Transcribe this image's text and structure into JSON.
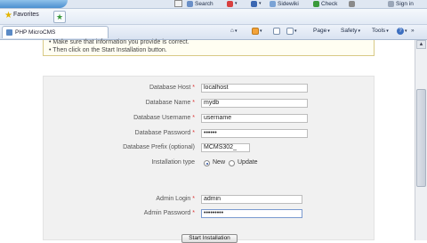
{
  "toolbar": {
    "search_label": "Search",
    "sidewiki_label": "Sidewiki",
    "check_label": "Check",
    "signin_label": "Sign in"
  },
  "favorites_bar": {
    "favorites_label": "Favorites"
  },
  "tab": {
    "title": "PHP MicroCMS"
  },
  "command_bar": {
    "page_label": "Page",
    "safety_label": "Safety",
    "tools_label": "Tools"
  },
  "info": {
    "line1": "• Make sure that information you provide is correct.",
    "line2": "• Then click on the Start Installation button."
  },
  "form": {
    "db_host_label": "Database Host",
    "db_host_value": "localhost",
    "db_name_label": "Database Name",
    "db_name_value": "mydb",
    "db_user_label": "Database Username",
    "db_user_value": "username",
    "db_pass_label": "Database Password",
    "db_pass_value": "••••••",
    "db_prefix_label": "Database Prefix (optional)",
    "db_prefix_value": "MCMS302_",
    "install_type_label": "Installation type",
    "install_new_label": "New",
    "install_update_label": "Update",
    "admin_login_label": "Admin Login",
    "admin_login_value": "admin",
    "admin_pass_label": "Admin Password",
    "admin_pass_value": "•••••••••",
    "required_mark": "*",
    "submit_label": "Start Installation"
  }
}
